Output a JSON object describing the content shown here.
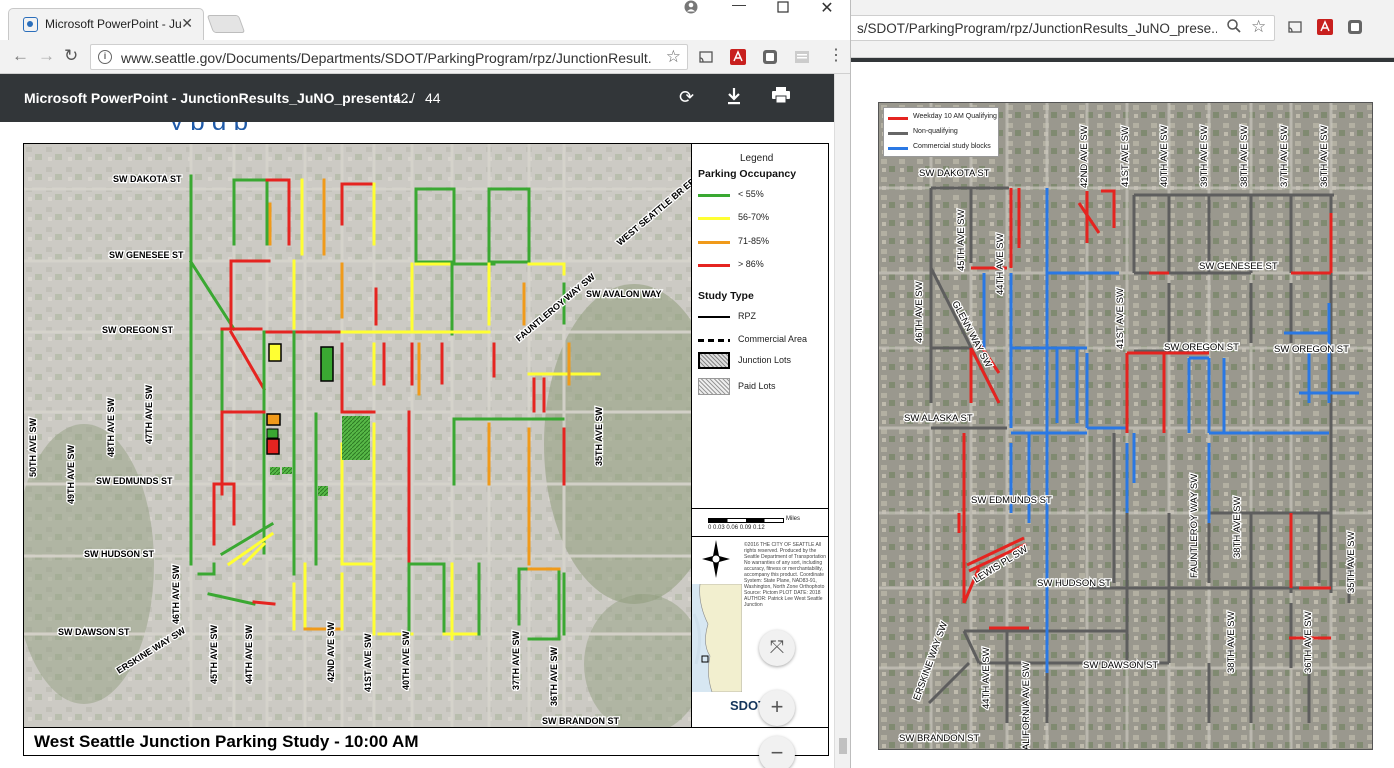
{
  "left_window": {
    "tab_title": "Microsoft PowerPoint - Ju",
    "url": "www.seattle.gov/Documents/Departments/SDOT/ParkingProgram/rpz/JunctionResult...",
    "pdf_title": "Microsoft PowerPoint - JunctionResults_JuNO_presenta...",
    "page_current": "42",
    "page_separator": "/",
    "page_total": "44",
    "map_title": "West Seattle Junction Parking Study - 10:00 AM",
    "legend": {
      "title": "Legend",
      "occupancy_heading": "Parking Occupancy",
      "occupancy_items": [
        {
          "label": "< 55%",
          "color": "#3aa832"
        },
        {
          "label": "56-70%",
          "color": "#ffff33"
        },
        {
          "label": "71-85%",
          "color": "#f09a1a"
        },
        {
          "label": "> 86%",
          "color": "#e52420"
        }
      ],
      "study_heading": "Study Type",
      "study_items": [
        {
          "label": "RPZ"
        },
        {
          "label": "Commercial Area"
        },
        {
          "label": "Junction Lots"
        },
        {
          "label": "Paid Lots"
        }
      ],
      "scale_unit": "Miles",
      "scale_ticks": "0  0.03  0.06  0.09  0.12",
      "fine_print": "©2016 THE CITY OF SEATTLE All rights reserved. Produced by the Seattle Department of Transportation No warranties of any sort, including accuracy, fitness or merchantability, accompany this product. Coordinate System: State Plane, NAD83-91, Washington, North Zone Orthophoto Source: Pictom PLOT DATE: 2018 AUTHOR: Patrick Lee West Seattle Junction",
      "logo": "SDOT"
    },
    "streets": {
      "dakota": "SW DAKOTA ST",
      "genesee": "SW GENESEE ST",
      "oregon": "SW OREGON ST",
      "edmunds": "SW EDMUNDS ST",
      "hudson": "SW HUDSON ST",
      "dawson": "SW DAWSON ST",
      "brandon": "SW BRANDON ST",
      "avalon": "SW AVALON WAY",
      "fauntleroy": "FAUNTLEROY WAY SW",
      "wsbridge": "WEST SEATTLE BR EB",
      "erskine": "ERSKINE WAY SW",
      "ave50": "50TH AVE SW",
      "ave49": "49TH AVE SW",
      "ave48": "48TH AVE SW",
      "ave47": "47TH AVE SW",
      "ave46": "46TH AVE SW",
      "ave45": "45TH AVE SW",
      "ave44": "44TH AVE SW",
      "ave42": "42ND AVE SW",
      "ave41": "41ST AVE SW",
      "ave40": "40TH AVE SW",
      "ave37": "37TH AVE SW",
      "ave36": "36TH AVE SW",
      "ave35": "35TH AVE SW"
    }
  },
  "right_window": {
    "url": "s/SDOT/ParkingProgram/rpz/JunctionResults_JuNO_prese...",
    "legend": [
      {
        "label": "Weekday 10 AM Qualifying",
        "color": "#e52420"
      },
      {
        "label": "Non-qualifying",
        "color": "#666666"
      },
      {
        "label": "Commercial study blocks",
        "color": "#2a78e4"
      }
    ],
    "streets": {
      "dakota": "SW DAKOTA ST",
      "genesee": "SW GENESEE ST",
      "oregon1": "SW OREGON ST",
      "oregon2": "SW OREGON ST",
      "alaska": "SW ALASKA ST",
      "edmunds": "SW EDMUNDS ST",
      "hudson": "SW HUDSON ST",
      "dawson": "SW DAWSON ST",
      "brandon": "SW BRANDON ST",
      "lewis": "LEWIS PL SW",
      "glenn": "GLENN WAY SW",
      "fauntleroy": "FAUNTLEROY WAY SW",
      "erskine": "ERSKINE WAY SW",
      "california": "CALIFORNIA AVE SW",
      "ave46": "46TH AVE SW",
      "ave45": "45TH AVE SW",
      "ave44a": "44TH AVE SW",
      "ave44b": "44TH AVE SW",
      "ave42": "42ND AVE SW",
      "ave41a": "41ST AVE SW",
      "ave41b": "41ST AVE SW",
      "ave40": "40TH AVE SW",
      "ave39": "39TH AVE SW",
      "ave38a": "38TH AVE SW",
      "ave38b": "38TH AVE SW",
      "ave38c": "38TH AVE SW",
      "ave37": "37TH AVE SW",
      "ave36a": "36TH AVE SW",
      "ave36b": "36TH AVE SW",
      "ave35": "35TH AVE SW"
    }
  }
}
